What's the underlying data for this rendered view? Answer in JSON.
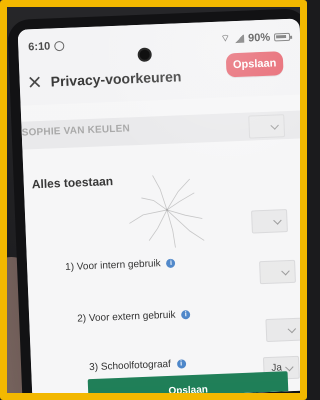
{
  "status": {
    "time": "6:10",
    "battery": "90%"
  },
  "header": {
    "title": "Privacy-voorkeuren",
    "save_label": "Opslaan"
  },
  "section": {
    "name": "SOPHIE VAN KEULEN"
  },
  "preferences": [
    {
      "label": "Alles toestaan",
      "value": ""
    },
    {
      "label": "1) Voor intern gebruik",
      "value": ""
    },
    {
      "label": "2) Voor extern gebruik",
      "value": ""
    },
    {
      "label": "3) Schoolfotograaf",
      "value": "Ja"
    }
  ],
  "footer": {
    "save_label": "Opslaan"
  },
  "icons": {
    "close": "close-icon",
    "info": "info-icon",
    "chevron": "chevron-down-icon",
    "whatsapp": "whatsapp-icon",
    "wifi": "wifi-icon",
    "signal": "signal-icon",
    "battery": "battery-icon"
  },
  "colors": {
    "accent_red": "#e45561",
    "accent_green": "#1f7f58",
    "info_blue": "#4d86c9",
    "frame_yellow": "#f3b800"
  }
}
